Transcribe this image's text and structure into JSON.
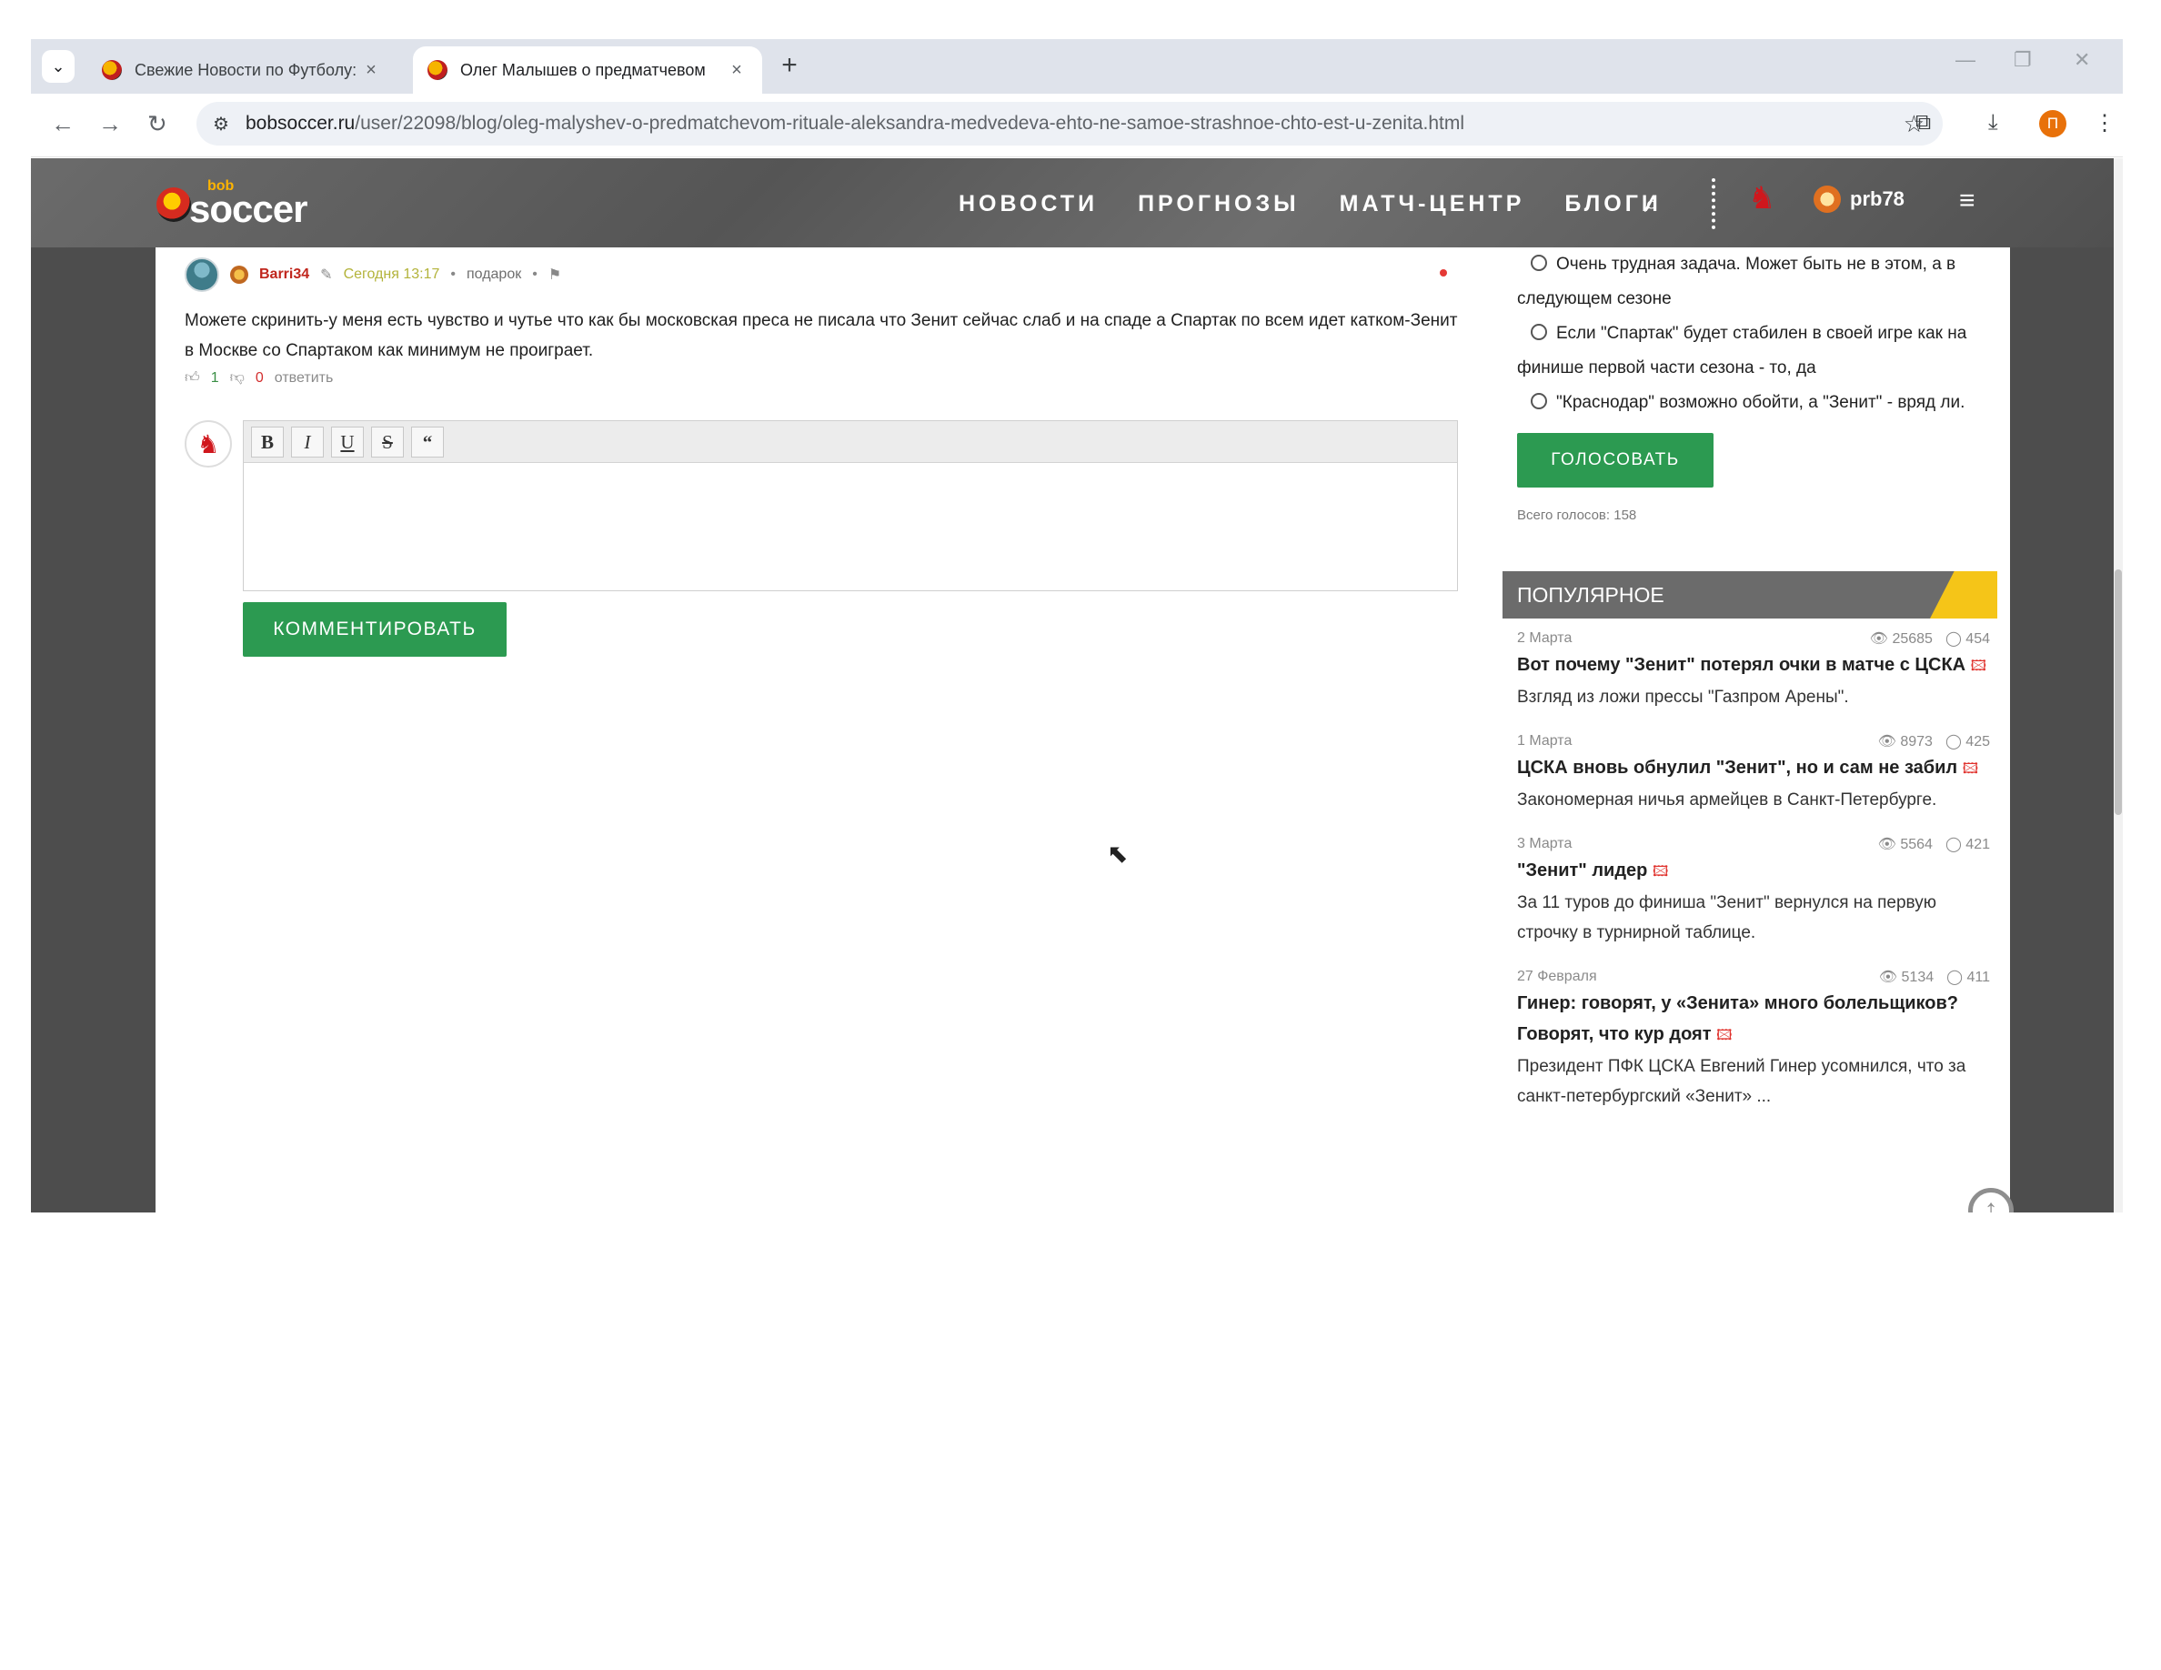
{
  "browser": {
    "tabs": [
      {
        "title": "Свежие Новости по Футболу: И",
        "active": false
      },
      {
        "title": "Олег Малышев о предматчевом",
        "active": true
      }
    ],
    "url_host": "bobsoccer.ru",
    "url_path": "/user/22098/blog/oleg-malyshev-o-predmatchevom-rituale-aleksandra-medvedeva-ehto-ne-samoe-strashnoe-chto-est-u-zenita.html",
    "profile_letter": "П"
  },
  "site": {
    "logo_small": "bob",
    "logo_main": "soccer",
    "nav": [
      "НОВОСТИ",
      "ПРОГНОЗЫ",
      "МАТЧ-ЦЕНТР",
      "БЛОГИ"
    ],
    "username": "prb78"
  },
  "comment": {
    "author": "Barri34",
    "time": "Сегодня 13:17",
    "gift": "подарок",
    "text": "Можете скринить-у меня есть чувство и чутье что как бы московская преса не писала что Зенит сейчас слаб и на спаде а Спартак по всем идет катком-Зенит в Москве со Спартаком как минимум не проиграет.",
    "likes": "1",
    "dislikes": "0",
    "reply_label": "ответить"
  },
  "editor": {
    "buttons": [
      "B",
      "I",
      "U",
      "S",
      "“"
    ],
    "submit_label": "КОММЕНТИРОВАТЬ"
  },
  "poll": {
    "options": [
      "Очень трудная задача. Может быть не в этом, а в следующем сезоне",
      "Если \"Спартак\" будет стабилен в своей игре как на финише первой части сезона - то, да",
      "\"Краснодар\" возможно обойти, а \"Зенит\" - вряд ли."
    ],
    "vote_label": "ГОЛОСОВАТЬ",
    "total": "Всего голосов: 158"
  },
  "popular": {
    "heading": "ПОПУЛЯРНОЕ",
    "items": [
      {
        "date": "2 Марта",
        "views": "25685",
        "comments": "454",
        "title": "Вот почему \"Зенит\" потерял очки в матче с ЦСКА",
        "desc": "Взгляд из ложи прессы \"Газпром Арены\"."
      },
      {
        "date": "1 Марта",
        "views": "8973",
        "comments": "425",
        "title": "ЦСКА вновь обнулил \"Зенит\", но и сам не забил",
        "desc": "Закономерная ничья армейцев в Санкт-Петербурге."
      },
      {
        "date": "3 Марта",
        "views": "5564",
        "comments": "421",
        "title": "\"Зенит\" лидер",
        "desc": "За 11 туров до финиша \"Зенит\" вернулся на первую строчку в турнирной таблице."
      },
      {
        "date": "27 Февраля",
        "views": "5134",
        "comments": "411",
        "title": "Гинер: говорят, у «Зенита» много болельщиков? Говорят, что кур доят",
        "desc": "Президент ПФК ЦСКА Евгений Гинер усомнился, что за санкт-петербургский «Зенит» ..."
      }
    ]
  },
  "colors": {
    "accent_green": "#2c9a51",
    "header_gray": "#6b6b6b",
    "stripe_yellow": "#f5c518",
    "author_red": "#c0261d"
  }
}
